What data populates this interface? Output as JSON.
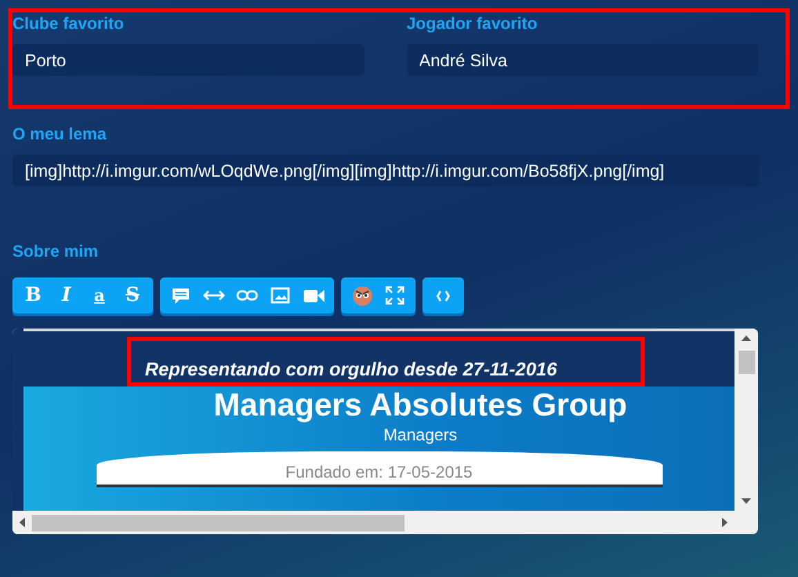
{
  "profile_fields": {
    "highlighted": true,
    "fields": [
      {
        "label": "Clube favorito",
        "value": "Porto"
      },
      {
        "label": "Jogador favorito",
        "value": "André Silva"
      }
    ]
  },
  "motto": {
    "label": "O meu lema",
    "value": "[img]http://i.imgur.com/wLOqdWe.png[/img][img]http://i.imgur.com/Bo58fjX.png[/img]"
  },
  "about": {
    "label": "Sobre mim",
    "toolbar": [
      [
        {
          "kind": "bold",
          "glyph": "B"
        },
        {
          "kind": "italic",
          "glyph": "I"
        },
        {
          "kind": "underline",
          "glyph": "a"
        },
        {
          "kind": "strike",
          "glyph": "S"
        }
      ],
      [
        {
          "kind": "quote"
        },
        {
          "kind": "hr"
        },
        {
          "kind": "link"
        },
        {
          "kind": "image"
        },
        {
          "kind": "video"
        }
      ],
      [
        {
          "kind": "emoji"
        },
        {
          "kind": "fullscreen"
        }
      ],
      [
        {
          "kind": "source"
        }
      ]
    ],
    "editor": {
      "signature": "Representando com orgulho desde 27-11-2016",
      "signature_highlighted": true,
      "banner": {
        "title": "Managers Absolutes Group",
        "subtitle": "Managers",
        "founded": "Fundado em: 17-05-2015"
      }
    }
  }
}
